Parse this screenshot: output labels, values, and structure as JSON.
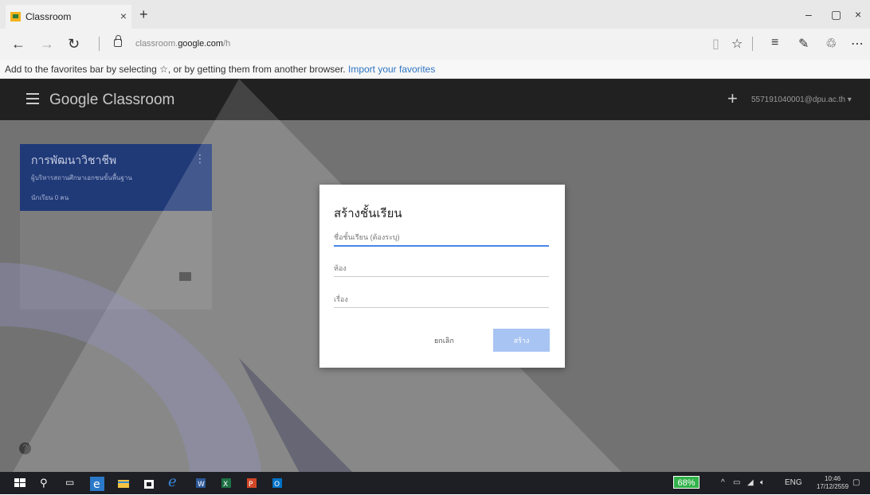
{
  "browser": {
    "tab_title": "Classroom",
    "tab_close": "×",
    "new_tab": "+",
    "url_prefix": "classroom.",
    "url_domain": "google.com",
    "url_path": "/h",
    "favbar_text": "Add to the favorites bar by selecting ☆, or by getting them from another browser.",
    "favbar_link": "Import your favorites"
  },
  "header": {
    "app_title": "Google Classroom",
    "add_label": "+",
    "account": "557191040001@dpu.ac.th ▾"
  },
  "class_card": {
    "title": "การพัฒนาวิชาชีพ",
    "subtitle": "ผู้บริหารสถานศึกษาเอกชนขั้นพื้นฐาน",
    "students": "นักเรียน 0 คน",
    "menu": "⋮"
  },
  "dialog": {
    "title": "สร้างชั้นเรียน",
    "name_placeholder": "ชื่อชั้นเรียน (ต้องระบุ)",
    "section_placeholder": "ห้อง",
    "subject_placeholder": "เรื่อง",
    "cancel_label": "ยกเลิก",
    "create_label": "สร้าง"
  },
  "help_label": "?",
  "taskbar": {
    "battery": "68%",
    "lang": "ENG",
    "time": "10:46",
    "date": "17/12/2559"
  },
  "colors": {
    "header_bg": "#212121",
    "card_banner": "#203a78",
    "overlay": "#727272",
    "accent": "#4a86e8",
    "create_button": "#a8c4f3",
    "battery": "#33b24b"
  }
}
